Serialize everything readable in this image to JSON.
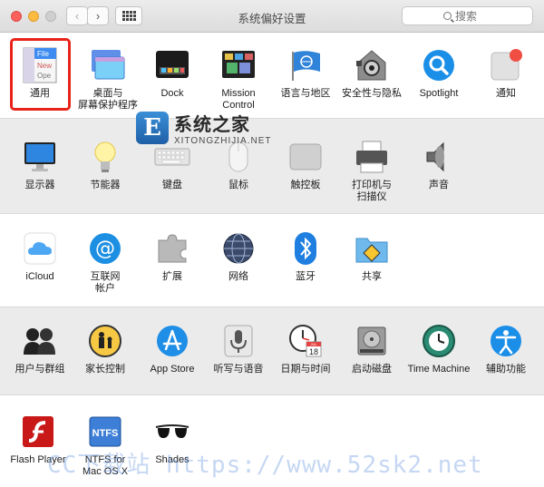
{
  "window": {
    "title": "系统偏好设置",
    "search_placeholder": "搜索"
  },
  "nav": {
    "back": "‹",
    "forward": "›"
  },
  "rows": [
    [
      {
        "name": "通用",
        "icon": "general-icon"
      },
      {
        "name": "桌面与\n屏幕保护程序",
        "icon": "desktop-screensaver-icon"
      },
      {
        "name": "Dock",
        "icon": "dock-icon"
      },
      {
        "name": "Mission\nControl",
        "icon": "mission-control-icon"
      },
      {
        "name": "语言与地区",
        "icon": "language-region-icon"
      },
      {
        "name": "安全性与隐私",
        "icon": "security-privacy-icon"
      },
      {
        "name": "Spotlight",
        "icon": "spotlight-icon"
      },
      {
        "name": "通知",
        "icon": "notifications-icon"
      }
    ],
    [
      {
        "name": "显示器",
        "icon": "displays-icon"
      },
      {
        "name": "节能器",
        "icon": "energy-saver-icon"
      },
      {
        "name": "键盘",
        "icon": "keyboard-icon"
      },
      {
        "name": "鼠标",
        "icon": "mouse-icon"
      },
      {
        "name": "触控板",
        "icon": "trackpad-icon"
      },
      {
        "name": "打印机与\n扫描仪",
        "icon": "printers-scanners-icon"
      },
      {
        "name": "声音",
        "icon": "sound-icon"
      }
    ],
    [
      {
        "name": "iCloud",
        "icon": "icloud-icon"
      },
      {
        "name": "互联网\n帐户",
        "icon": "internet-accounts-icon"
      },
      {
        "name": "扩展",
        "icon": "extensions-icon"
      },
      {
        "name": "网络",
        "icon": "network-icon"
      },
      {
        "name": "蓝牙",
        "icon": "bluetooth-icon"
      },
      {
        "name": "共享",
        "icon": "sharing-icon"
      }
    ],
    [
      {
        "name": "用户与群组",
        "icon": "users-groups-icon"
      },
      {
        "name": "家长控制",
        "icon": "parental-controls-icon"
      },
      {
        "name": "App Store",
        "icon": "app-store-icon"
      },
      {
        "name": "听写与语音",
        "icon": "dictation-speech-icon"
      },
      {
        "name": "日期与时间",
        "icon": "date-time-icon"
      },
      {
        "name": "启动磁盘",
        "icon": "startup-disk-icon"
      },
      {
        "name": "Time Machine",
        "icon": "time-machine-icon"
      },
      {
        "name": "辅助功能",
        "icon": "accessibility-icon"
      }
    ],
    [
      {
        "name": "Flash Player",
        "icon": "flash-player-icon"
      },
      {
        "name": "NTFS for\nMac OS X",
        "icon": "ntfs-icon"
      },
      {
        "name": "Shades",
        "icon": "shades-icon"
      }
    ]
  ],
  "icon_text": {
    "general": [
      "File",
      "New",
      "Ope"
    ],
    "ntfs": "NTFS",
    "calendar_day": "18",
    "calendar_month": "JUL"
  },
  "watermark": {
    "site_cn": "系统之家",
    "site_en": "XITONGZHIJIA.NET",
    "footer": "CC下载站 https://www.52sk2.net"
  },
  "colors": {
    "highlight": "#e8231a",
    "accent_blue": "#1b8ee8"
  }
}
